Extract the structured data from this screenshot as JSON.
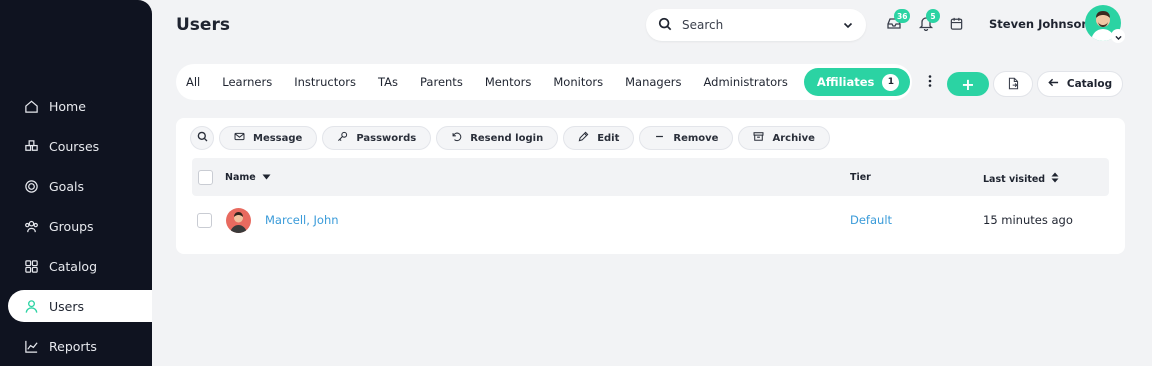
{
  "sidebar": {
    "items": [
      {
        "label": "Home",
        "icon": "home-icon",
        "active": false
      },
      {
        "label": "Courses",
        "icon": "courses-icon",
        "active": false
      },
      {
        "label": "Goals",
        "icon": "goals-icon",
        "active": false
      },
      {
        "label": "Groups",
        "icon": "groups-icon",
        "active": false
      },
      {
        "label": "Catalog",
        "icon": "catalog-icon",
        "active": false
      },
      {
        "label": "Users",
        "icon": "users-icon",
        "active": true
      },
      {
        "label": "Reports",
        "icon": "reports-icon",
        "active": false
      }
    ]
  },
  "header": {
    "title": "Users",
    "search_placeholder": "Search",
    "inbox_count": "36",
    "notifications_count": "5",
    "user_name": "Steven Johnson"
  },
  "tabs": {
    "items": [
      "All",
      "Learners",
      "Instructors",
      "TAs",
      "Parents",
      "Mentors",
      "Monitors",
      "Managers",
      "Administrators"
    ],
    "active_label": "Affiliates",
    "active_count": "1"
  },
  "actions": {
    "add_label": "+",
    "catalog_label": "Catalog"
  },
  "toolbar": {
    "message": "Message",
    "passwords": "Passwords",
    "resend_login": "Resend login",
    "edit": "Edit",
    "remove": "Remove",
    "archive": "Archive"
  },
  "table": {
    "columns": {
      "name": "Name",
      "tier": "Tier",
      "last_visited": "Last visited"
    },
    "rows": [
      {
        "name": "Marcell, John",
        "tier": "Default",
        "last_visited": "15 minutes ago"
      }
    ]
  },
  "colors": {
    "accent": "#2bd3a3",
    "sidebar": "#0f1320",
    "link": "#3a9bd9"
  }
}
